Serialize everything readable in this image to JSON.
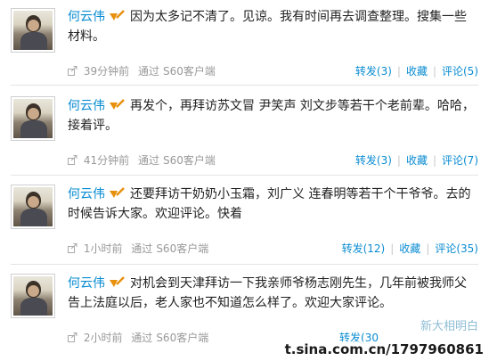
{
  "posts": [
    {
      "author": "何云伟",
      "text": "因为太多记不清了。见谅。我有时间再去调查整理。搜集一些材料。",
      "time": "39分钟前",
      "via_label": "通过",
      "client": "S60客户端",
      "repost": "转发(3)",
      "favorite": "收藏",
      "comment": "评论(5)"
    },
    {
      "author": "何云伟",
      "text": "再发个，再拜访苏文冒 尹笑声 刘文步等若干个老前辈。哈哈，接着评。",
      "time": "41分钟前",
      "via_label": "通过",
      "client": "S60客户端",
      "repost": "转发(3)",
      "favorite": "收藏",
      "comment": "评论(7)"
    },
    {
      "author": "何云伟",
      "text": "还要拜访干奶奶小玉霜，刘广义 连春明等若干个干爷爷。去的时候告诉大家。欢迎评论。快着",
      "time": "1小时前",
      "via_label": "通过",
      "client": "S60客户端",
      "repost": "转发(12)",
      "favorite": "收藏",
      "comment": "评论(35)"
    },
    {
      "author": "何云伟",
      "text": "对机会到天津拜访一下我亲师爷杨志刚先生，几年前被我师父告上法庭以后，老人家也不知道怎么样了。欢迎大家评论。",
      "time": "2小时前",
      "via_label": "通过",
      "client": "S60客户端",
      "repost": "转发(30",
      "favorite": "",
      "comment": ""
    }
  ],
  "separator": "|",
  "watermark": "t.sina.com.cn/1797960861",
  "logo_overlay": "新大相明白",
  "colors": {
    "link": "#0a8cd2",
    "meta": "#999999",
    "vip": "#e8900c"
  }
}
